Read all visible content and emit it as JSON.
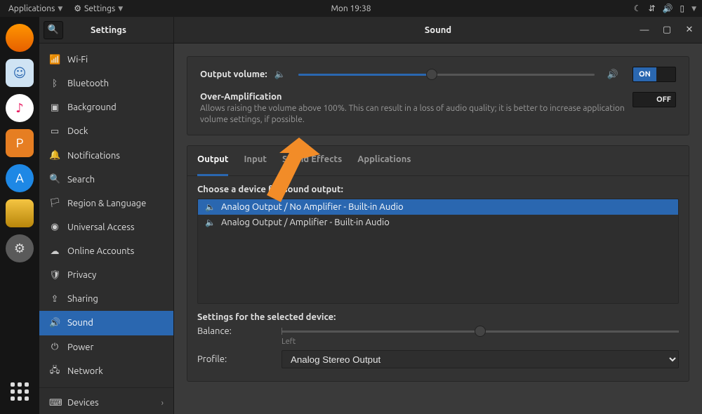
{
  "topbar": {
    "applications_label": "Applications",
    "app_name": "Settings",
    "clock": "Mon 19:38"
  },
  "window": {
    "sidebar_title": "Settings",
    "main_title": "Sound"
  },
  "sidebar": {
    "items": [
      {
        "icon": "wifi",
        "label": "Wi-Fi"
      },
      {
        "icon": "bt",
        "label": "Bluetooth"
      },
      {
        "icon": "bg",
        "label": "Background"
      },
      {
        "icon": "dock",
        "label": "Dock"
      },
      {
        "icon": "bell",
        "label": "Notifications"
      },
      {
        "icon": "search",
        "label": "Search"
      },
      {
        "icon": "globe",
        "label": "Region & Language"
      },
      {
        "icon": "access",
        "label": "Universal Access"
      },
      {
        "icon": "cloud",
        "label": "Online Accounts"
      },
      {
        "icon": "privacy",
        "label": "Privacy"
      },
      {
        "icon": "share",
        "label": "Sharing"
      },
      {
        "icon": "sound",
        "label": "Sound"
      },
      {
        "icon": "power",
        "label": "Power"
      },
      {
        "icon": "net",
        "label": "Network"
      }
    ],
    "devices_label": "Devices"
  },
  "sound": {
    "output_volume_label": "Output volume:",
    "volume_percent": 45,
    "volume_on_label": "ON",
    "overamp_title": "Over-Amplification",
    "overamp_desc": "Allows raising the volume above 100%. This can result in a loss of audio quality; it is better to increase application volume settings, if possible.",
    "overamp_off_label": "OFF",
    "tabs": [
      "Output",
      "Input",
      "Sound Effects",
      "Applications"
    ],
    "active_tab": 0,
    "choose_label": "Choose a device for sound output:",
    "devices": [
      "Analog Output / No Amplifier - Built-in Audio",
      "Analog Output / Amplifier - Built-in Audio"
    ],
    "selected_device": 0,
    "settings_heading": "Settings for the selected device:",
    "balance_label": "Balance:",
    "balance_left_label": "Left",
    "profile_label": "Profile:",
    "profile_value": "Analog Stereo Output"
  },
  "colors": {
    "accent": "#2a67b0",
    "annotation": "#f28c28"
  }
}
